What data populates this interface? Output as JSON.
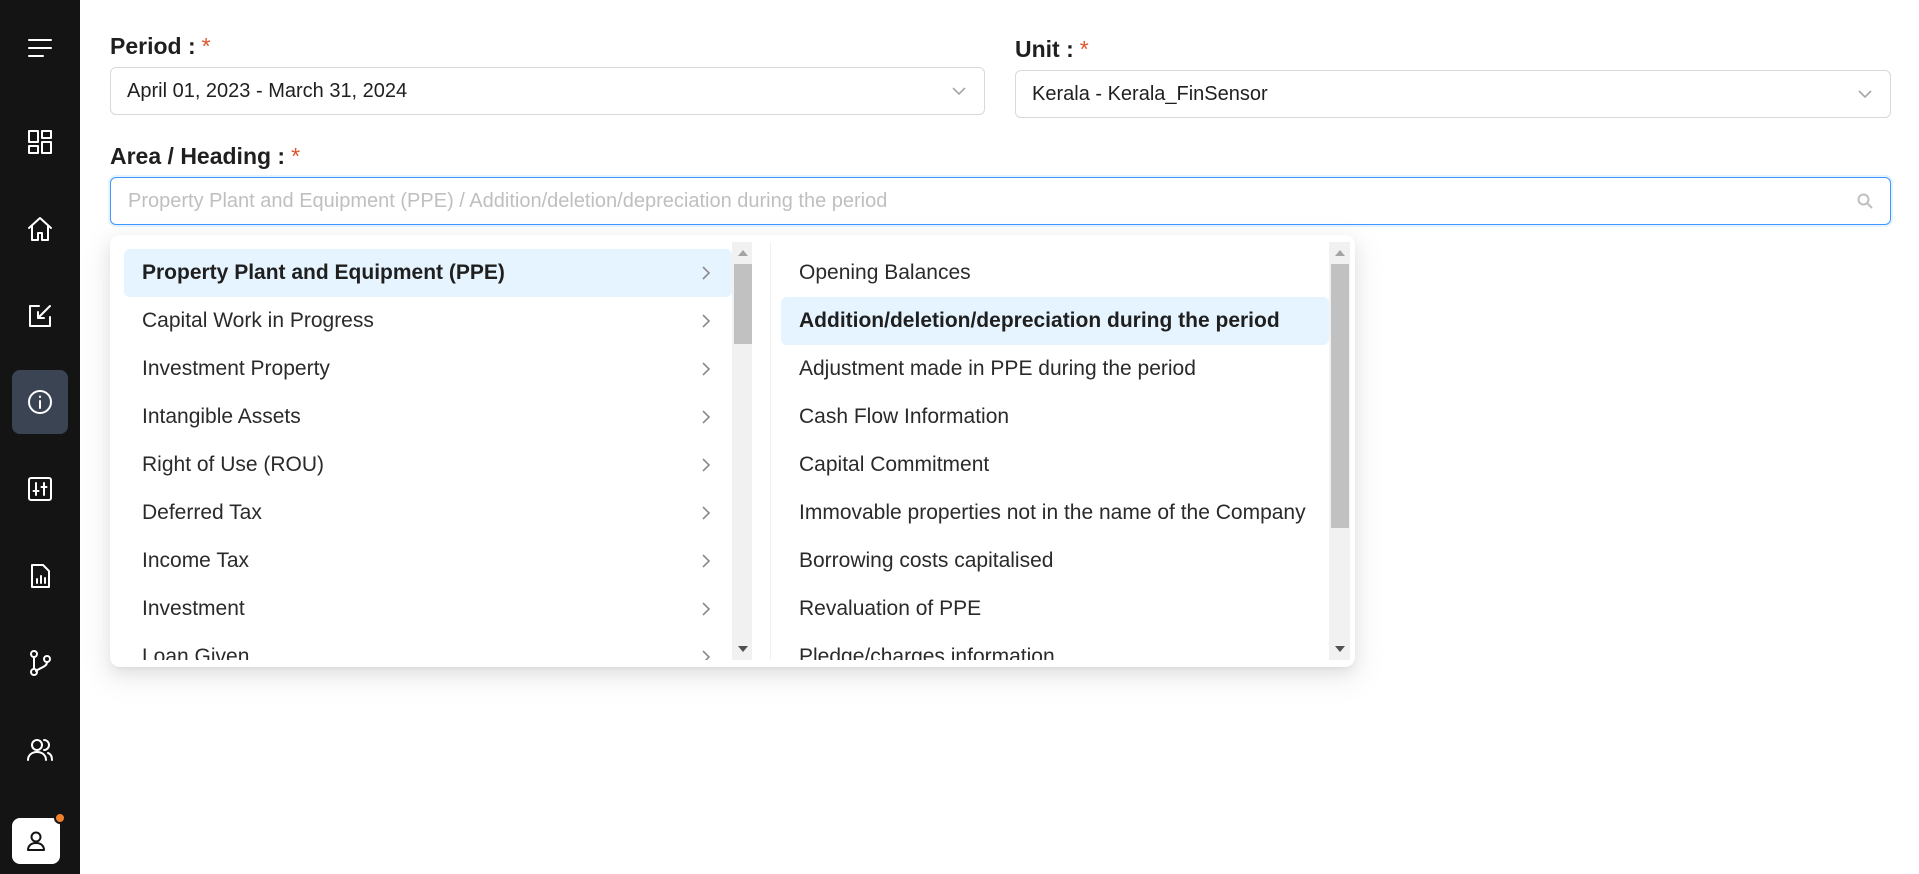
{
  "sidebar": {
    "items": [
      {
        "name": "menu-icon",
        "active": false
      },
      {
        "name": "dashboard-icon",
        "active": false
      },
      {
        "name": "home-icon",
        "active": false
      },
      {
        "name": "edit-icon",
        "active": false
      },
      {
        "name": "info-icon",
        "active": true
      },
      {
        "name": "sliders-icon",
        "active": false
      },
      {
        "name": "report-icon",
        "active": false
      },
      {
        "name": "branch-icon",
        "active": false
      },
      {
        "name": "users-icon",
        "active": false
      }
    ],
    "profile_icon": "user-icon",
    "notification_color": "#f0812a"
  },
  "form": {
    "period": {
      "label": "Period :",
      "required_mark": "*",
      "value": "April 01, 2023 - March 31, 2024"
    },
    "unit": {
      "label": "Unit :",
      "required_mark": "*",
      "value": "Kerala - Kerala_FinSensor"
    },
    "area": {
      "label": "Area / Heading :",
      "required_mark": "*",
      "value": "",
      "placeholder": "Property Plant and Equipment (PPE) / Addition/deletion/depreciation during the period"
    }
  },
  "cascader": {
    "level1": [
      "Property Plant and Equipment (PPE)",
      "Capital Work in Progress",
      "Investment Property",
      "Intangible Assets",
      "Right of Use (ROU)",
      "Deferred Tax",
      "Income Tax",
      "Investment",
      "Loan Given"
    ],
    "level1_selected": "Property Plant and Equipment (PPE)",
    "level2": [
      "Opening Balances",
      "Addition/deletion/depreciation during the period",
      "Adjustment made in PPE during the period",
      "Cash Flow Information",
      "Capital Commitment",
      "Immovable properties not in the name of the Company",
      "Borrowing costs capitalised",
      "Revaluation of PPE",
      "Pledge/charges information"
    ],
    "level2_selected": "Addition/deletion/depreciation during the period"
  },
  "colors": {
    "sidebar_bg": "#141414",
    "active_nav_bg": "#3a4452",
    "accent": "#4096ff",
    "selected_item_bg": "#e6f4ff",
    "required": "#e0552c"
  }
}
